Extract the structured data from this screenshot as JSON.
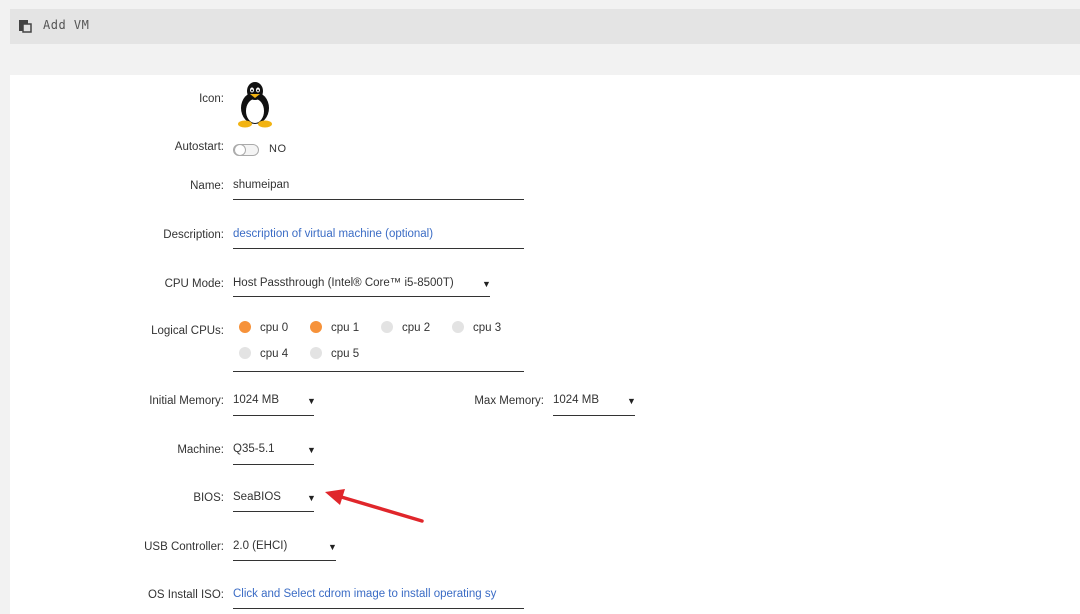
{
  "window": {
    "title": "Add VM",
    "icon": "clipboard-icon"
  },
  "form": {
    "icon_label": "Icon:",
    "icon_name": "linux-penguin-icon",
    "autostart": {
      "label": "Autostart:",
      "state": "NO"
    },
    "name": {
      "label": "Name:",
      "value": "shumeipan"
    },
    "description": {
      "label": "Description:",
      "placeholder": "description of virtual machine (optional)"
    },
    "cpu_mode": {
      "label": "CPU Mode:",
      "value": "Host Passthrough (Intel® Core™ i5-8500T)"
    },
    "logical_cpus": {
      "label": "Logical CPUs:",
      "cpus": [
        {
          "name": "cpu 0",
          "selected": true
        },
        {
          "name": "cpu 1",
          "selected": true
        },
        {
          "name": "cpu 2",
          "selected": false
        },
        {
          "name": "cpu 3",
          "selected": false
        },
        {
          "name": "cpu 4",
          "selected": false
        },
        {
          "name": "cpu 5",
          "selected": false
        }
      ]
    },
    "initial_memory": {
      "label": "Initial Memory:",
      "value": "1024 MB"
    },
    "max_memory": {
      "label": "Max Memory:",
      "value": "1024 MB"
    },
    "machine": {
      "label": "Machine:",
      "value": "Q35-5.1"
    },
    "bios": {
      "label": "BIOS:",
      "value": "SeaBIOS"
    },
    "usb_controller": {
      "label": "USB Controller:",
      "value": "2.0 (EHCI)"
    },
    "os_install_iso": {
      "label": "OS Install ISO:",
      "placeholder": "Click and Select cdrom image to install operating sy"
    }
  },
  "colors": {
    "accent_orange": "#f6923a",
    "link_blue": "#3b6cc5",
    "annotation_red": "#e0262b"
  }
}
